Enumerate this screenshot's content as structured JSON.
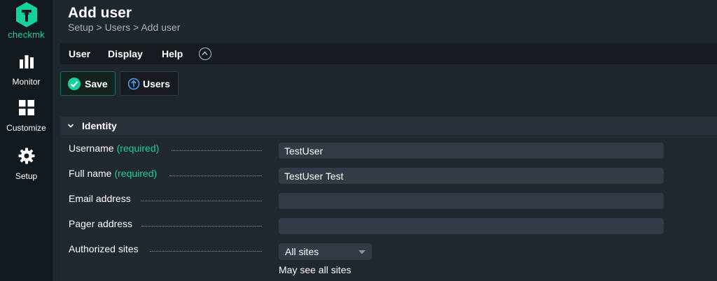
{
  "sidebar": {
    "logo_text": "checkmk",
    "items": [
      {
        "label": "Monitor",
        "icon": "bar-chart-icon"
      },
      {
        "label": "Customize",
        "icon": "grid-icon"
      },
      {
        "label": "Setup",
        "icon": "gear-icon"
      }
    ]
  },
  "header": {
    "title": "Add user",
    "breadcrumb": [
      "Setup",
      "Users",
      "Add user"
    ],
    "separator": ">"
  },
  "menubar": {
    "items": [
      "User",
      "Display",
      "Help"
    ],
    "collapse_icon": "chevron-up-circle-icon"
  },
  "toolbar": {
    "save_label": "Save",
    "users_label": "Users"
  },
  "section": {
    "title": "Identity",
    "fields": {
      "username": {
        "label": "Username",
        "required": "(required)",
        "value": "TestUser"
      },
      "fullname": {
        "label": "Full name",
        "required": "(required)",
        "value": "TestUser Test"
      },
      "email": {
        "label": "Email address",
        "value": ""
      },
      "pager": {
        "label": "Pager address",
        "value": ""
      },
      "sites": {
        "label": "Authorized sites",
        "selected": "All sites",
        "hint": "May see all sites"
      }
    }
  },
  "colors": {
    "accent": "#15d1a0",
    "sidebar_bg": "#12191f",
    "page_bg": "#1e262e",
    "field_bg": "#333c46"
  }
}
